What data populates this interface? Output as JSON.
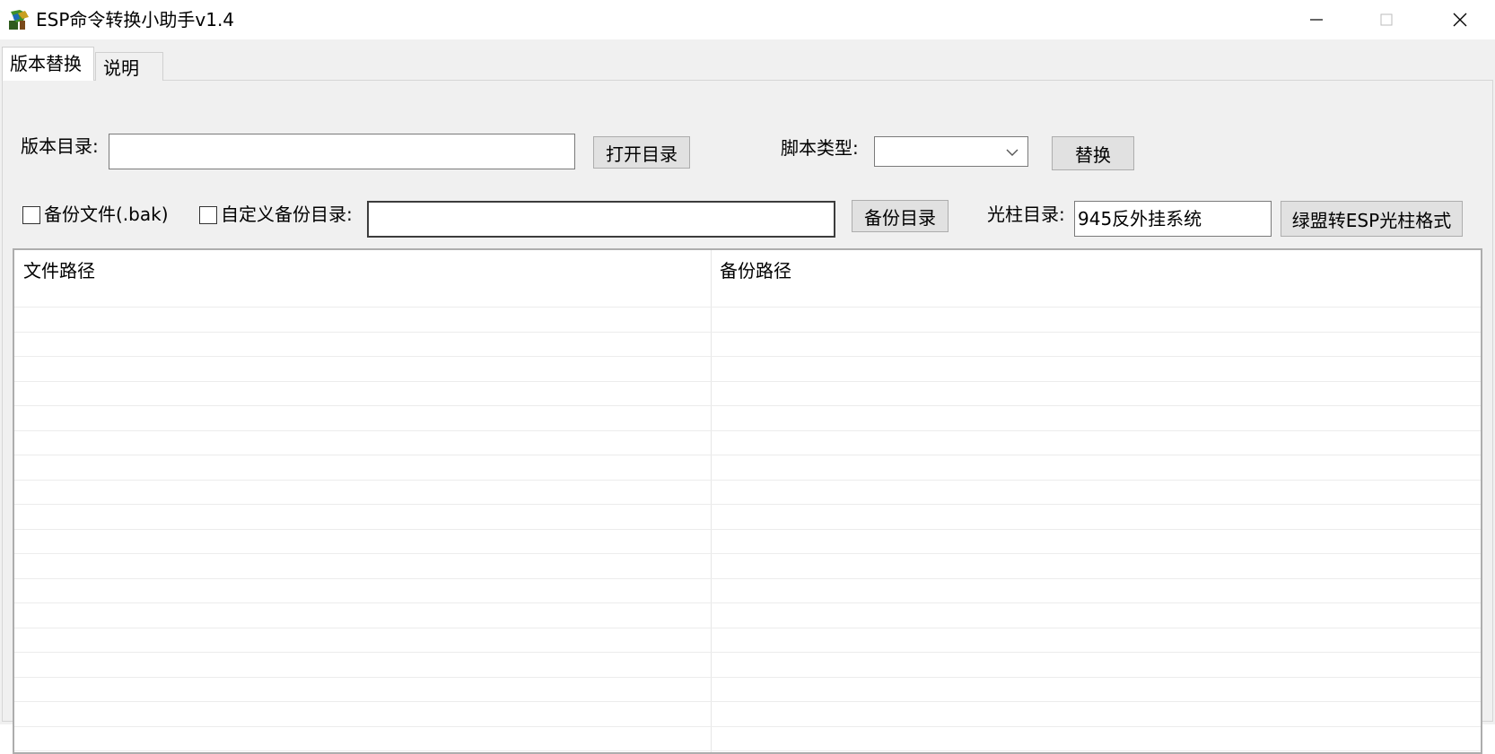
{
  "window": {
    "title": "ESP命令转换小助手v1.4",
    "controls": [
      "minimize-icon",
      "maximize-icon",
      "close-icon"
    ]
  },
  "tabs": [
    {
      "label": "版本替换",
      "active": true
    },
    {
      "label": "说明",
      "active": false
    }
  ],
  "form": {
    "version_dir_label": "版本目录:",
    "version_dir_value": "",
    "open_dir_button": "打开目录",
    "script_type_label": "脚本类型:",
    "script_type_value": "",
    "replace_button": "替换",
    "backup_file_label": "备份文件(.bak)",
    "backup_file_checked": false,
    "custom_backup_label": "自定义备份目录:",
    "custom_backup_checked": false,
    "custom_backup_value": "",
    "backup_dir_button": "备份目录",
    "light_dir_label": "光柱目录:",
    "light_dir_value": "945反外挂系统",
    "convert_button": "绿盟转ESP光柱格式"
  },
  "table": {
    "columns": [
      "文件路径",
      "备份路径"
    ],
    "rows": []
  },
  "colors": {
    "window_bg": "#f0f0f0",
    "button_bg": "#e1e1e1",
    "button_border": "#adadad"
  }
}
